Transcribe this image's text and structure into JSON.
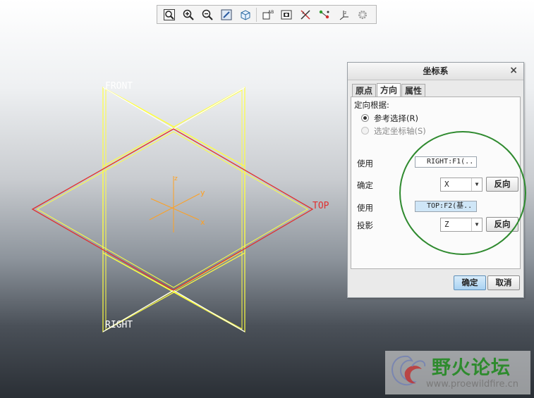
{
  "toolbar": {
    "buttons": [
      {
        "icon": "zoom-fit-icon"
      },
      {
        "icon": "zoom-in-icon"
      },
      {
        "icon": "zoom-out-icon"
      },
      {
        "icon": "repaint-icon"
      },
      {
        "icon": "display-style-icon"
      },
      {
        "icon": "saved-views-icon"
      },
      {
        "icon": "view-manager-icon"
      },
      {
        "icon": "datum-display-icon"
      },
      {
        "icon": "datum-points-icon"
      },
      {
        "icon": "coordinate-systems-icon"
      },
      {
        "icon": "settings-icon"
      }
    ]
  },
  "viewport": {
    "labels": {
      "front": "FRONT",
      "top": "TOP",
      "right": "RIGHT"
    },
    "axes": {
      "x": "x",
      "y": "y",
      "z": "z"
    },
    "colors": {
      "plane_yellow": "#ffff40",
      "plane_red": "#e03030",
      "plane_white": "#ffffff",
      "axes_orange": "#ffa020"
    }
  },
  "dialog": {
    "title": "坐标系",
    "close": "×",
    "tabs": [
      {
        "label": "原点",
        "active": false
      },
      {
        "label": "方向",
        "active": true
      },
      {
        "label": "属性",
        "active": false
      }
    ],
    "orient_by": "定向根据:",
    "radio_ref": "参考选择(R)",
    "radio_axis": "选定坐标轴(S)",
    "use1_label": "使用",
    "use1_value": "RIGHT:F1(..",
    "determine_label": "确定",
    "determine_value": "X",
    "flip1": "反向",
    "use2_label": "使用",
    "use2_value": "TOP:F2(基..",
    "project_label": "投影",
    "project_value": "Z",
    "flip2": "反向",
    "ok": "确定",
    "cancel": "取消"
  },
  "watermark": {
    "title": "野火论坛",
    "url": "www.proewildfire.cn"
  }
}
